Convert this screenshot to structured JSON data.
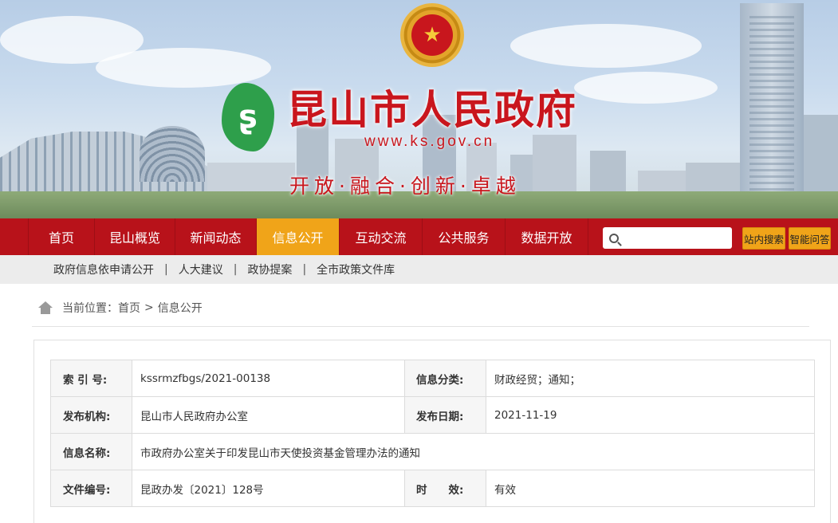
{
  "banner": {
    "title": "昆山市人民政府",
    "url": "www.ks.gov.cn",
    "slogan": "开放·融合·创新·卓越",
    "emblem_icon": "national-emblem-icon",
    "logo_icon": "kunshan-logo-icon",
    "title_color": "#c9161d"
  },
  "nav": {
    "items": [
      {
        "label": "首页"
      },
      {
        "label": "昆山概览"
      },
      {
        "label": "新闻动态"
      },
      {
        "label": "信息公开",
        "active": true
      },
      {
        "label": "互动交流"
      },
      {
        "label": "公共服务"
      },
      {
        "label": "数据开放"
      }
    ],
    "search_placeholder": "",
    "site_search_label": "站内搜索",
    "smart_qa_label": "智能问答",
    "bar_color": "#b8121a",
    "active_color": "#f0a419"
  },
  "subnav": {
    "items": [
      "政府信息依申请公开",
      "人大建议",
      "政协提案",
      "全市政策文件库"
    ],
    "separator": "|"
  },
  "breadcrumb": {
    "prefix": "当前位置：",
    "items": [
      "首页",
      "信息公开"
    ],
    "separator": ">"
  },
  "info": {
    "index_label": "索 引 号:",
    "index_value": "kssrmzfbgs/2021-00138",
    "category_label": "信息分类:",
    "category_value": "财政经贸；通知；",
    "publisher_label": "发布机构:",
    "publisher_value": "昆山市人民政府办公室",
    "date_label": "发布日期:",
    "date_value": "2021-11-19",
    "name_label": "信息名称:",
    "name_value": "市政府办公室关于印发昆山市天使投资基金管理办法的通知",
    "docno_label": "文件编号:",
    "docno_value": "昆政办发〔2021〕128号",
    "validity_label": "时　　效:",
    "validity_value": "有效"
  }
}
